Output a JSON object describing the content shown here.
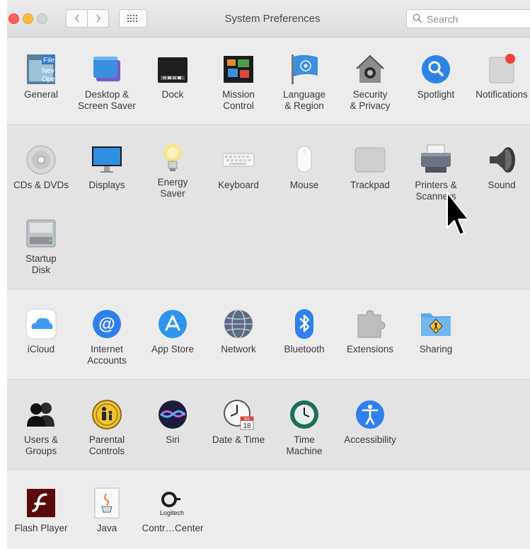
{
  "window": {
    "title": "System Preferences"
  },
  "search": {
    "placeholder": "Search"
  },
  "sections": [
    {
      "items": [
        {
          "label": "General",
          "icon": "general-icon"
        },
        {
          "label": "Desktop &\nScreen Saver",
          "icon": "desktop-icon"
        },
        {
          "label": "Dock",
          "icon": "dock-icon"
        },
        {
          "label": "Mission\nControl",
          "icon": "mission-control-icon"
        },
        {
          "label": "Language\n& Region",
          "icon": "language-flag-icon"
        },
        {
          "label": "Security\n& Privacy",
          "icon": "security-house-icon"
        },
        {
          "label": "Spotlight",
          "icon": "spotlight-icon"
        },
        {
          "label": "Notifications",
          "icon": "notifications-icon"
        }
      ]
    },
    {
      "items": [
        {
          "label": "CDs & DVDs",
          "icon": "cd-icon"
        },
        {
          "label": "Displays",
          "icon": "display-icon"
        },
        {
          "label": "Energy\nSaver",
          "icon": "lightbulb-icon"
        },
        {
          "label": "Keyboard",
          "icon": "keyboard-icon"
        },
        {
          "label": "Mouse",
          "icon": "mouse-icon"
        },
        {
          "label": "Trackpad",
          "icon": "trackpad-icon"
        },
        {
          "label": "Printers &\nScanners",
          "icon": "printer-icon"
        },
        {
          "label": "Sound",
          "icon": "speaker-icon"
        },
        {
          "label": "Startup\nDisk",
          "icon": "disk-icon"
        }
      ]
    },
    {
      "items": [
        {
          "label": "iCloud",
          "icon": "icloud-icon"
        },
        {
          "label": "Internet\nAccounts",
          "icon": "at-icon"
        },
        {
          "label": "App Store",
          "icon": "app-store-icon"
        },
        {
          "label": "Network",
          "icon": "globe-icon"
        },
        {
          "label": "Bluetooth",
          "icon": "bluetooth-icon"
        },
        {
          "label": "Extensions",
          "icon": "puzzle-icon"
        },
        {
          "label": "Sharing",
          "icon": "sharing-folder-icon"
        }
      ]
    },
    {
      "items": [
        {
          "label": "Users &\nGroups",
          "icon": "users-icon"
        },
        {
          "label": "Parental\nControls",
          "icon": "parental-icon"
        },
        {
          "label": "Siri",
          "icon": "siri-icon"
        },
        {
          "label": "Date & Time",
          "icon": "clock-calendar-icon",
          "calendar_day": "18",
          "calendar_month": "JUL"
        },
        {
          "label": "Time\nMachine",
          "icon": "time-machine-icon"
        },
        {
          "label": "Accessibility",
          "icon": "accessibility-icon"
        }
      ]
    },
    {
      "items": [
        {
          "label": "Flash Player",
          "icon": "flash-icon"
        },
        {
          "label": "Java",
          "icon": "java-icon"
        },
        {
          "label": "Contr…Center",
          "icon": "logitech-icon",
          "brand": "Logitech"
        }
      ]
    }
  ],
  "colors": {
    "window_bg": "#ececec",
    "section_alt_bg": "#e3e3e3",
    "accent_blue": "#2f80ed"
  }
}
